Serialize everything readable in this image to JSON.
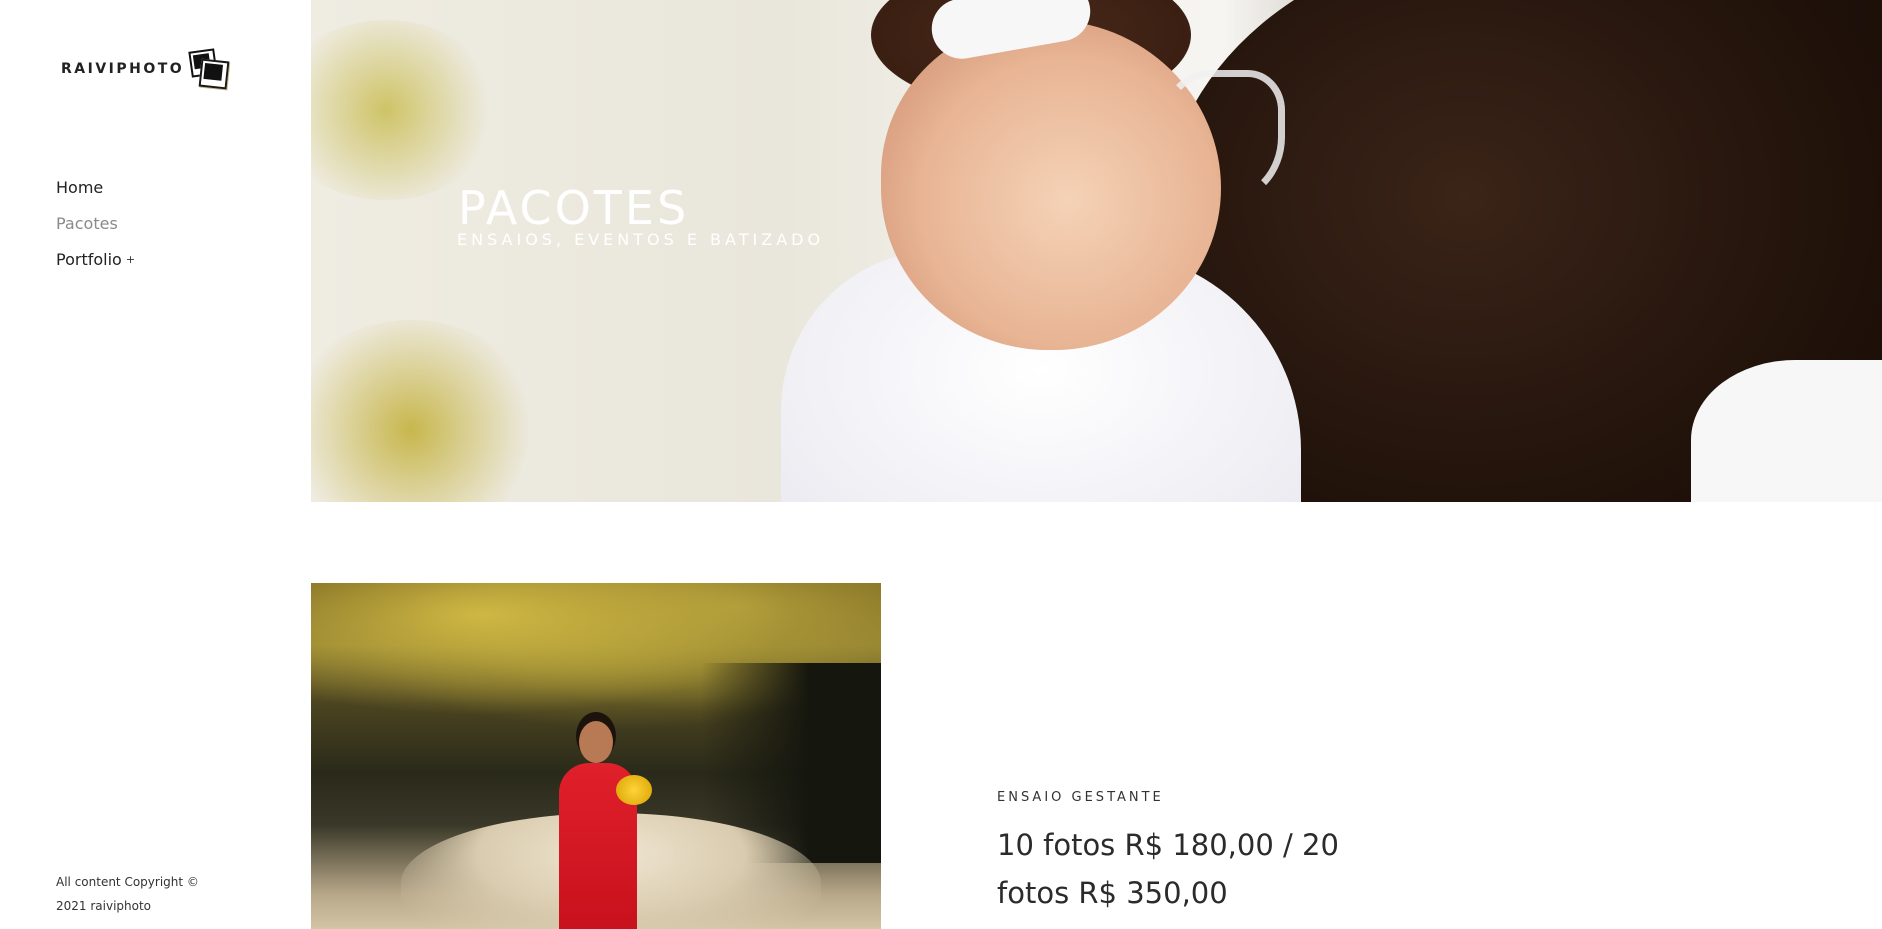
{
  "sidebar": {
    "logo_text": "RAIVIPHOTO",
    "logo_icon": "polaroid-photos-icon",
    "nav": [
      {
        "label": "Home",
        "state": "default"
      },
      {
        "label": "Pacotes",
        "state": "active"
      },
      {
        "label": "Portfolio",
        "state": "default",
        "expand": "+"
      }
    ],
    "copyright_line1": "All content Copyright ©",
    "copyright_line2": "2021 raiviphoto"
  },
  "hero": {
    "title": "PACOTES",
    "subtitle": "ENSAIOS, EVENTOS E BATIZADO"
  },
  "package": {
    "label": "ENSAIO GESTANTE",
    "price_line1": "10 fotos R$ 180,00 / 20",
    "price_line2": "fotos R$ 350,00"
  },
  "colors": {
    "text": "#2b2b2b",
    "muted_nav": "#8a8a8a",
    "background": "#ffffff"
  }
}
